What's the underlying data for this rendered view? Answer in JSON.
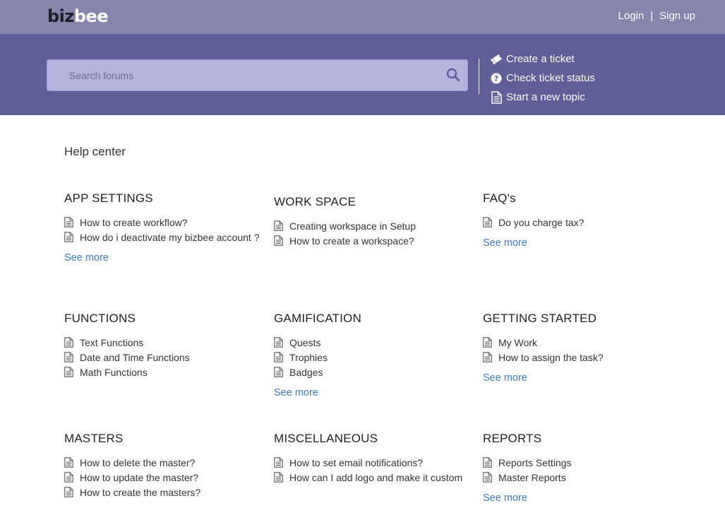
{
  "header": {
    "logo_part1": "biz",
    "logo_part2": "bee",
    "login": "Login",
    "separator": "|",
    "signup": "Sign up"
  },
  "hero": {
    "search_placeholder": "Search forums",
    "actions": [
      {
        "label": "Create a ticket",
        "icon": "ticket-icon"
      },
      {
        "label": "Check ticket status",
        "icon": "question-circle-icon"
      },
      {
        "label": "Start a new topic",
        "icon": "document-icon"
      }
    ]
  },
  "page_title": "Help center",
  "see_more": "See more",
  "sections": [
    {
      "title": "APP SETTINGS",
      "articles": [
        "How to create workflow?",
        "How do i deactivate my bizbee account ?"
      ],
      "see_more": true
    },
    {
      "title": "WORK SPACE",
      "articles": [
        "Creating workspace in Setup",
        "How to create a workspace?"
      ],
      "see_more": false
    },
    {
      "title": "FAQ's",
      "articles": [
        "Do you charge tax?"
      ],
      "see_more": true
    },
    {
      "title": "FUNCTIONS",
      "articles": [
        "Text Functions",
        "Date and Time Functions",
        "Math Functions"
      ],
      "see_more": false
    },
    {
      "title": "GAMIFICATION",
      "articles": [
        "Quests",
        "Trophies",
        "Badges"
      ],
      "see_more": true
    },
    {
      "title": "GETTING STARTED",
      "articles": [
        "My Work",
        "How to assign the task?"
      ],
      "see_more": true
    },
    {
      "title": "MASTERS",
      "articles": [
        "How to delete the master?",
        "How to update the master?",
        "How to create the masters?"
      ],
      "see_more": false
    },
    {
      "title": "MISCELLANEOUS",
      "articles": [
        "How to set email notifications?",
        "How can I add logo and make it custom"
      ],
      "see_more": false
    },
    {
      "title": "REPORTS",
      "articles": [
        "Reports Settings",
        "Master Reports"
      ],
      "see_more": true
    }
  ],
  "colors": {
    "topbar": "#8584ad",
    "hero": "#5f5e96",
    "search_bg": "#b4b3dc",
    "link": "#3e7cbf"
  }
}
